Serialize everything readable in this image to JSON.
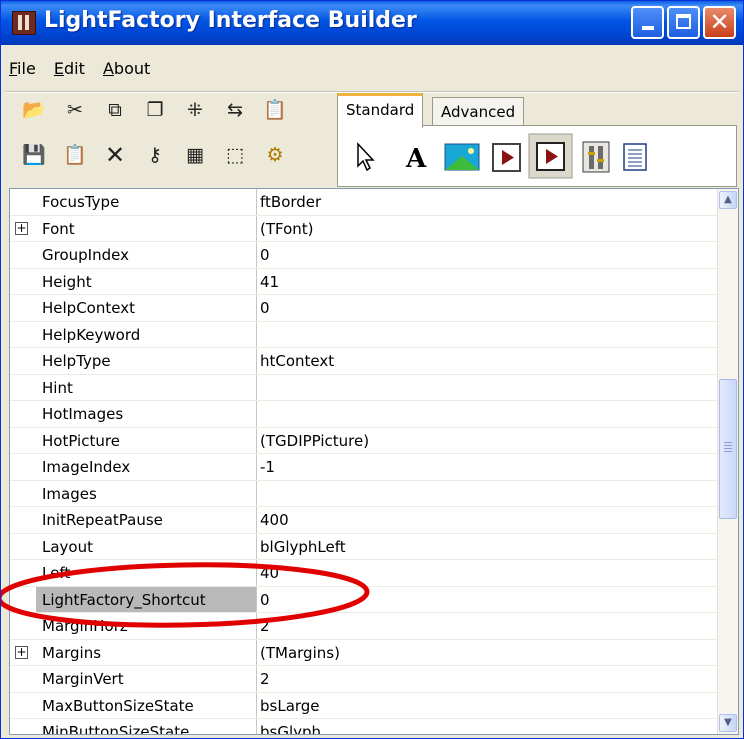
{
  "window": {
    "title": "LightFactory Interface Builder"
  },
  "menu": {
    "file": {
      "key": "F",
      "rest": "ile"
    },
    "edit": {
      "key": "E",
      "rest": "dit"
    },
    "about": {
      "key": "A",
      "rest": "bout"
    }
  },
  "palette": {
    "tabs": [
      "Standard",
      "Advanced"
    ],
    "active_tab": "Standard"
  },
  "properties": [
    {
      "name": "FocusType",
      "value": "ftBorder",
      "expandable": false
    },
    {
      "name": "Font",
      "value": "(TFont)",
      "expandable": true
    },
    {
      "name": "GroupIndex",
      "value": "0",
      "expandable": false
    },
    {
      "name": "Height",
      "value": "41",
      "expandable": false
    },
    {
      "name": "HelpContext",
      "value": "0",
      "expandable": false
    },
    {
      "name": "HelpKeyword",
      "value": "",
      "expandable": false
    },
    {
      "name": "HelpType",
      "value": "htContext",
      "expandable": false
    },
    {
      "name": "Hint",
      "value": "",
      "expandable": false
    },
    {
      "name": "HotImages",
      "value": "",
      "expandable": false
    },
    {
      "name": "HotPicture",
      "value": "(TGDIPPicture)",
      "expandable": false
    },
    {
      "name": "ImageIndex",
      "value": "-1",
      "expandable": false
    },
    {
      "name": "Images",
      "value": "",
      "expandable": false
    },
    {
      "name": "InitRepeatPause",
      "value": "400",
      "expandable": false
    },
    {
      "name": "Layout",
      "value": "blGlyphLeft",
      "expandable": false
    },
    {
      "name": "Left",
      "value": "40",
      "expandable": false
    },
    {
      "name": "LightFactory_Shortcut",
      "value": "0",
      "expandable": false,
      "selected": true
    },
    {
      "name": "MarginHorz",
      "value": "2",
      "expandable": false
    },
    {
      "name": "Margins",
      "value": "(TMargins)",
      "expandable": true
    },
    {
      "name": "MarginVert",
      "value": "2",
      "expandable": false
    },
    {
      "name": "MaxButtonSizeState",
      "value": "bsLarge",
      "expandable": false
    },
    {
      "name": "MinButtonSizeState",
      "value": "bsGlyph",
      "expandable": false
    }
  ],
  "icons": {
    "toolbar_row1": [
      "open-folder-icon",
      "cut-icon",
      "copy-icon",
      "duplicate-icon",
      "align-icon",
      "tab-order-icon",
      "paste-special-icon"
    ],
    "toolbar_row2": [
      "save-icon",
      "paste-icon",
      "delete-icon",
      "key-icon",
      "grid-icon",
      "resize-icon",
      "settings-gear-icon"
    ],
    "palette": [
      "pointer-icon",
      "label-component-icon",
      "image-component-icon",
      "button-component-icon",
      "toggle-button-component-icon",
      "panel-component-icon",
      "list-component-icon"
    ]
  },
  "colors": {
    "titlebar": "#0055e5",
    "annotation": "#e00000",
    "selected_row": "#b9b9b9"
  }
}
